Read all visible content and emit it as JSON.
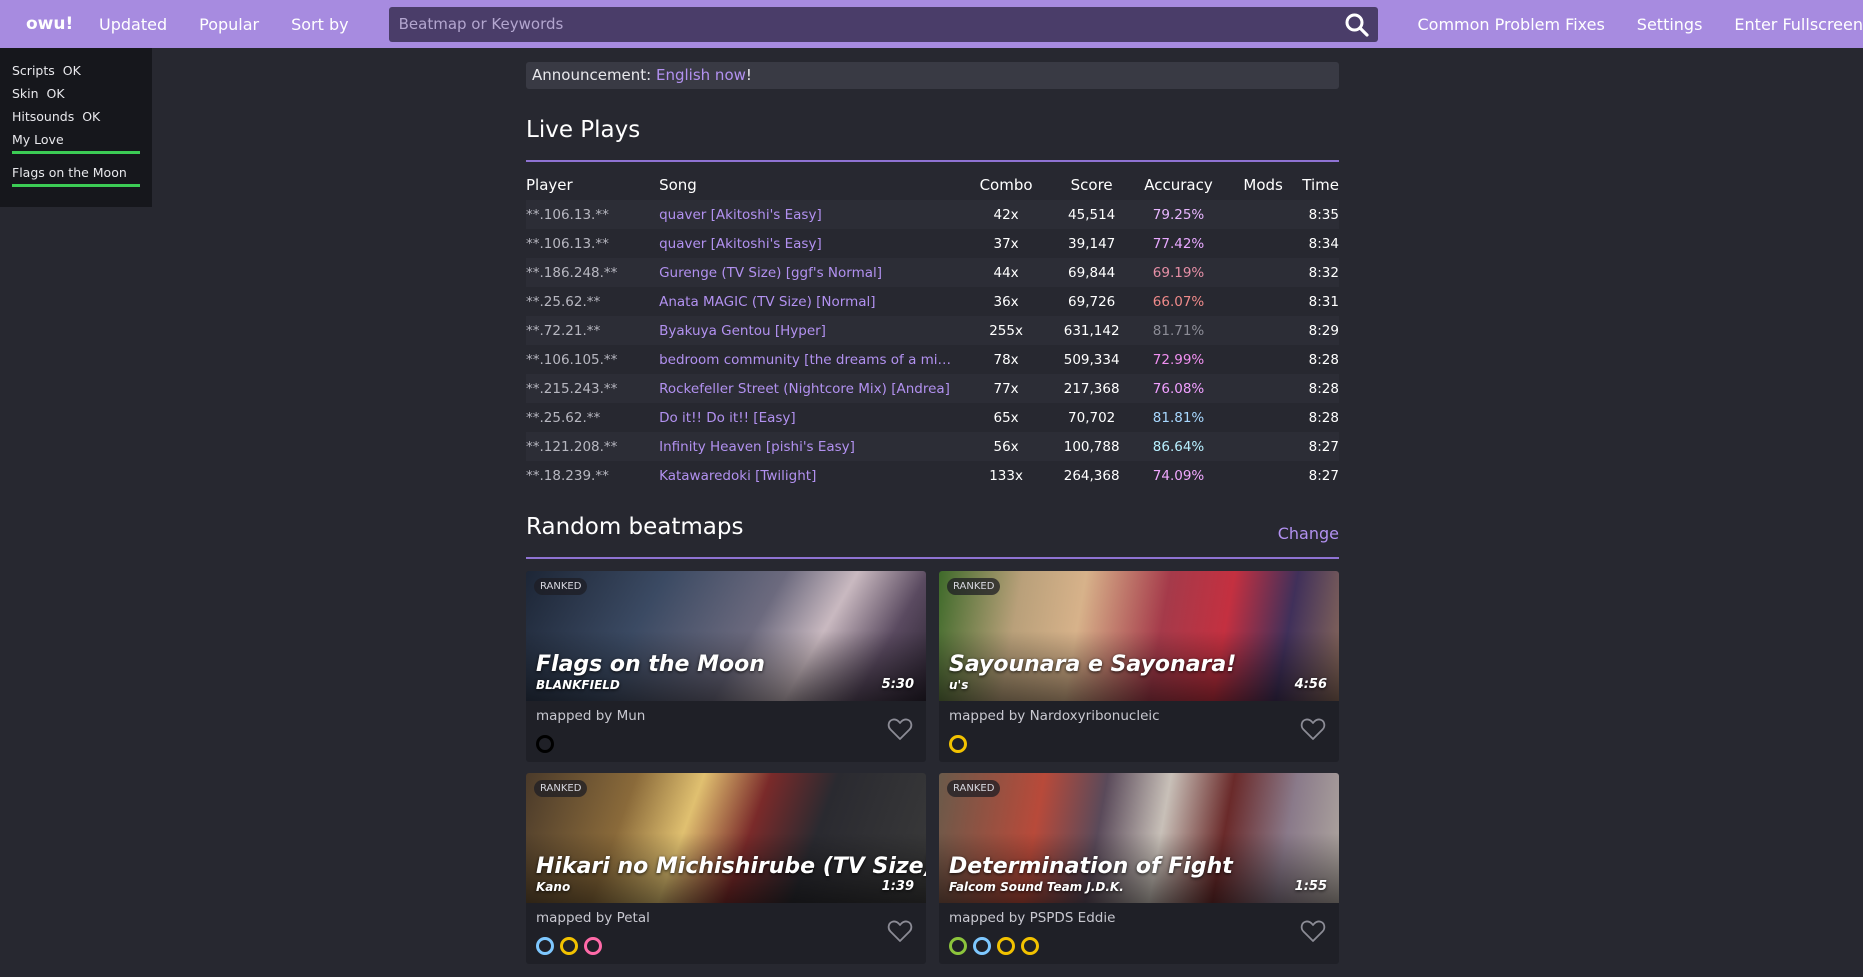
{
  "topbar": {
    "logo": "owu!",
    "nav": [
      "Updated",
      "Popular",
      "Sort by"
    ],
    "search_placeholder": "Beatmap or Keywords",
    "right": [
      "Common Problem Fixes",
      "Settings",
      "Enter Fullscreen"
    ],
    "accent": "#a78be0"
  },
  "status": {
    "rows": [
      {
        "name": "Scripts",
        "state": "OK"
      },
      {
        "name": "Skin",
        "state": "OK"
      },
      {
        "name": "Hitsounds",
        "state": "OK"
      }
    ],
    "songs": [
      "My Love",
      "Flags on the Moon"
    ]
  },
  "announcement": {
    "prefix": "Announcement: ",
    "link": "English now",
    "suffix": "!"
  },
  "live_plays": {
    "title": "Live Plays",
    "headers": [
      "Player",
      "Song",
      "Combo",
      "Score",
      "Accuracy",
      "Mods",
      "Time"
    ],
    "rows": [
      {
        "player": "**.106.13.**",
        "song": "quaver [Akitoshi's Easy]",
        "combo": "42x",
        "score": "45,514",
        "acc": "79.25%",
        "acc_color": "#e8b6ff",
        "mods": "",
        "time": "8:35"
      },
      {
        "player": "**.106.13.**",
        "song": "quaver [Akitoshi's Easy]",
        "combo": "37x",
        "score": "39,147",
        "acc": "77.42%",
        "acc_color": "#e8a8ff",
        "mods": "",
        "time": "8:34"
      },
      {
        "player": "**.186.248.**",
        "song": "Gurenge (TV Size) [ggf's Normal]",
        "combo": "44x",
        "score": "69,844",
        "acc": "69.19%",
        "acc_color": "#e58fa6",
        "mods": "",
        "time": "8:32"
      },
      {
        "player": "**.25.62.**",
        "song": "Anata MAGIC (TV Size) [Normal]",
        "combo": "36x",
        "score": "69,726",
        "acc": "66.07%",
        "acc_color": "#ef8a8a",
        "mods": "",
        "time": "8:31"
      },
      {
        "player": "**.72.21.**",
        "song": "Byakuya Gentou [Hyper]",
        "combo": "255x",
        "score": "631,142",
        "acc": "81.71%",
        "acc_color": "#8c8c96",
        "mods": "",
        "time": "8:29"
      },
      {
        "player": "**.106.105.**",
        "song": "bedroom community [the dreams of a mid…",
        "combo": "78x",
        "score": "509,334",
        "acc": "72.99%",
        "acc_color": "#f090f0",
        "mods": "",
        "time": "8:28"
      },
      {
        "player": "**.215.243.**",
        "song": "Rockefeller Street (Nightcore Mix) [Andrea]",
        "combo": "77x",
        "score": "217,368",
        "acc": "76.08%",
        "acc_color": "#f0a0ff",
        "mods": "",
        "time": "8:28"
      },
      {
        "player": "**.25.62.**",
        "song": "Do it!! Do it!! [Easy]",
        "combo": "65x",
        "score": "70,702",
        "acc": "81.81%",
        "acc_color": "#a8d8ff",
        "mods": "",
        "time": "8:28"
      },
      {
        "player": "**.121.208.**",
        "song": "Infinity Heaven [pishi's Easy]",
        "combo": "56x",
        "score": "100,788",
        "acc": "86.64%",
        "acc_color": "#b8f0ff",
        "mods": "",
        "time": "8:27"
      },
      {
        "player": "**.18.239.**",
        "song": "Katawaredoki [Twilight]",
        "combo": "133x",
        "score": "264,368",
        "acc": "74.09%",
        "acc_color": "#f0a8ff",
        "mods": "",
        "time": "8:27"
      }
    ]
  },
  "random": {
    "title": "Random beatmaps",
    "change": "Change",
    "cards": [
      {
        "status": "RANKED",
        "title": "Flags on the Moon",
        "artist": "BLANKFIELD",
        "length": "5:30",
        "mapper": "mapped by Mun",
        "diffs": [
          "#000000"
        ],
        "bg": "linear-gradient(120deg,#1d2636 0%,#3b4a63 30%,#6c6a7e 55%,#c9b9c0 70%,#5a4a60 85%,#2a2230 100%)"
      },
      {
        "status": "RANKED",
        "title": "Sayounara e Sayonara!",
        "artist": "u's",
        "length": "4:56",
        "mapper": "mapped by Nardoxyribonucleic",
        "diffs": [
          "#f2c200"
        ],
        "bg": "linear-gradient(100deg,#3e6a2a 0%,#b9a07a 20%,#d7b28a 35%,#a53a4a 55%,#c43040 70%,#40305a 85%,#8a6a5a 100%)"
      },
      {
        "status": "RANKED",
        "title": "Hikari no Michishirube (TV Size)",
        "artist": "Kano",
        "length": "1:39",
        "mapper": "mapped by Petal",
        "diffs": [
          "#7ec8ff",
          "#f2c200",
          "#ff6aa8"
        ],
        "bg": "linear-gradient(110deg,#4a3a2a 0%,#8a6a3a 25%,#e0c070 40%,#7a2a2a 55%,#2a2a30 70%,#3a3a3a 100%)"
      },
      {
        "status": "RANKED",
        "title": "Determination of Fight",
        "artist": "Falcom Sound Team J.D.K.",
        "length": "1:55",
        "mapper": "mapped by PSPDS Eddie",
        "diffs": [
          "#8cc43c",
          "#7ec8ff",
          "#f2c200",
          "#f2c200"
        ],
        "bg": "linear-gradient(100deg,#6a5a4a 0%,#b84a3a 25%,#5a4a5a 40%,#c8c0b8 55%,#6a2a2a 70%,#8a7a8a 85%,#b0a8a0 100%)"
      }
    ]
  }
}
